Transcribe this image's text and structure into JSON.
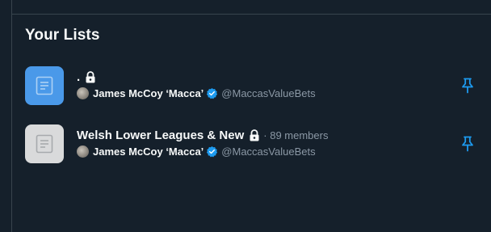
{
  "section": {
    "title": "Your Lists"
  },
  "lists": [
    {
      "name": ".",
      "private": true,
      "members": "",
      "owner_name": "James McCoy ‘Macca’",
      "owner_handle": "@MaccasValueBets",
      "thumb_color": "#4a99e9",
      "icon": "list-document-icon",
      "pin_icon": "pin-icon"
    },
    {
      "name": "Welsh Lower Leagues & New",
      "private": true,
      "members": "· 89 members",
      "owner_name": "James McCoy ‘Macca’",
      "owner_handle": "@MaccasValueBets",
      "thumb_color": "#d9dadb",
      "icon": "list-document-icon",
      "pin_icon": "pin-icon"
    }
  ],
  "colors": {
    "background": "#15202b",
    "accent": "#1d9bf0",
    "muted_text": "#8b98a5",
    "primary_text": "#f7f9f9"
  }
}
